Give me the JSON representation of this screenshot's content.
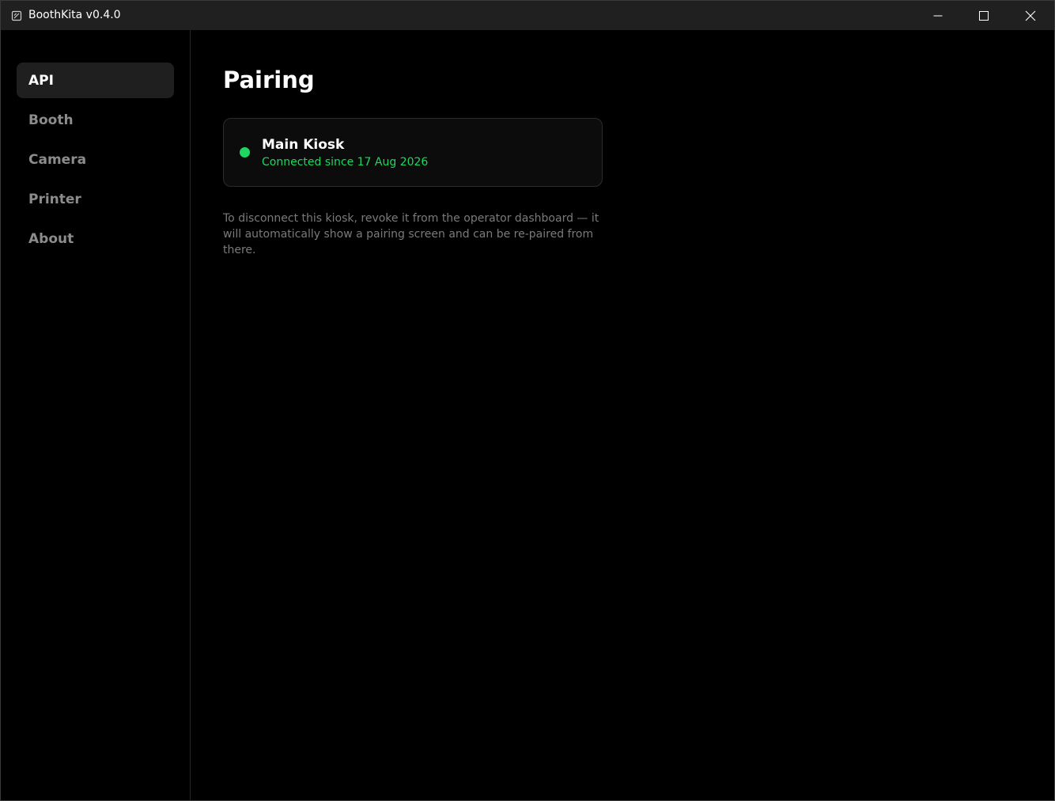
{
  "window": {
    "title": "BoothKita v0.4.0",
    "app_icon": "app-logo-icon",
    "controls": {
      "minimize": "minimize-icon",
      "maximize": "maximize-icon",
      "close": "close-icon"
    }
  },
  "sidebar": {
    "items": [
      {
        "label": "API",
        "active": true
      },
      {
        "label": "Booth",
        "active": false
      },
      {
        "label": "Camera",
        "active": false
      },
      {
        "label": "Printer",
        "active": false
      },
      {
        "label": "About",
        "active": false
      }
    ]
  },
  "main": {
    "title": "Pairing",
    "kiosk": {
      "name": "Main Kiosk",
      "status": "Connected since 17 Aug 2026",
      "status_color": "#1ed760"
    },
    "help_text": "To disconnect this kiosk, revoke it from the operator dashboard — it will automatically show a pairing screen and can be re-paired from there."
  },
  "colors": {
    "background": "#000000",
    "titlebar": "#202020",
    "active_nav": "#1f1f1f",
    "accent_green": "#1ed760"
  }
}
